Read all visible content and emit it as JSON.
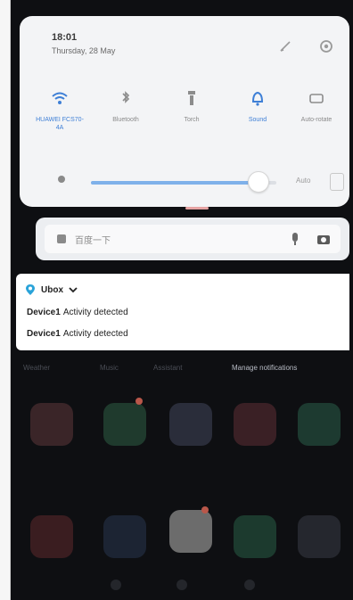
{
  "status": {
    "time": "18:01",
    "date": "Thursday, 28 May"
  },
  "quick_tiles": [
    {
      "label": "HUAWEI FCS70-4A",
      "icon": "wifi-icon",
      "active": true
    },
    {
      "label": "Bluetooth",
      "icon": "bluetooth-icon",
      "active": false
    },
    {
      "label": "Torch",
      "icon": "torch-icon",
      "active": false
    },
    {
      "label": "Sound",
      "icon": "sound-icon",
      "active": true
    },
    {
      "label": "Auto-rotate",
      "icon": "rotate-icon",
      "active": false
    }
  ],
  "brightness": {
    "level": 0.9,
    "auto_label": "Auto"
  },
  "search": {
    "placeholder": "百度一下"
  },
  "notification": {
    "app_name": "Ubox",
    "lines": [
      {
        "device": "Device1",
        "text": "Activity detected"
      },
      {
        "device": "Device1",
        "text": "Activity detected"
      }
    ]
  },
  "home_tabs": [
    "Weather",
    "Music",
    "Assistant",
    "Manage notifications"
  ],
  "colors": {
    "accent": "#3e7fd6",
    "panel": "#f3f4f6",
    "dark_bg": "#0e0f12",
    "ubox_icon": "#2aa3d9"
  }
}
